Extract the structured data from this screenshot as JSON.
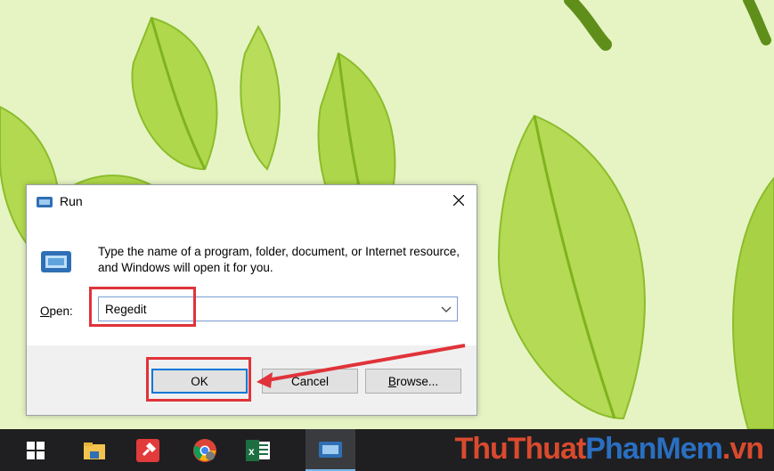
{
  "dialog": {
    "title": "Run",
    "description": "Type the name of a program, folder, document, or Internet resource, and Windows will open it for you.",
    "open_label_first": "O",
    "open_label_rest": "pen:",
    "open_value": "Regedit",
    "ok_label": "OK",
    "cancel_label": "Cancel",
    "browse_label_first": "B",
    "browse_label_rest": "rowse..."
  },
  "taskbar": {
    "items": [
      "windows-start",
      "file-explorer",
      "pin-app",
      "chrome",
      "excel",
      "run"
    ]
  },
  "watermark": {
    "part1": "ThuThuat",
    "part2": "PhanMem",
    "part3": ".vn"
  },
  "colors": {
    "highlight": "#e0333a",
    "accent": "#0078d7",
    "taskbar": "#1f1f21",
    "wallpaper": "#e6f4c4"
  }
}
